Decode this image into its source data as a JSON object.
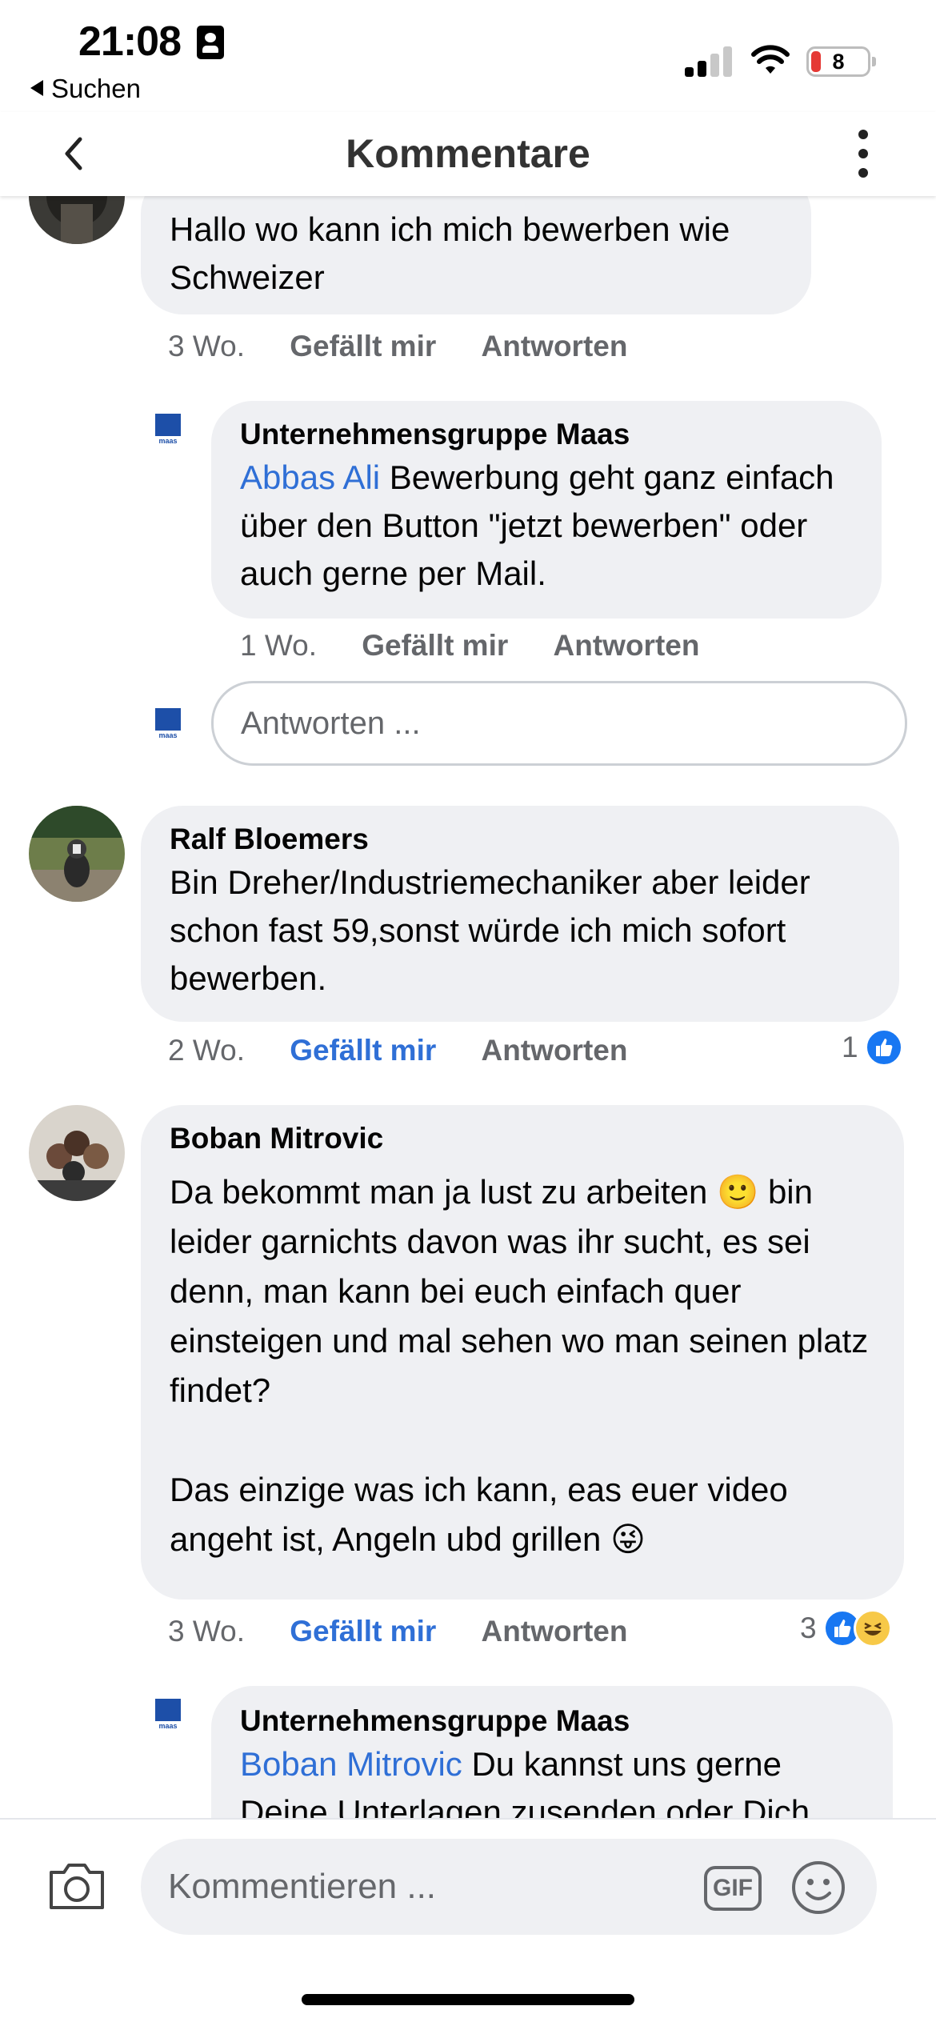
{
  "status_bar": {
    "time": "21:08",
    "back_app": "Suchen",
    "battery": "8"
  },
  "header": {
    "title": "Kommentare"
  },
  "comments": [
    {
      "text": "Hallo wo kann ich mich bewerben wie Schweizer",
      "time": "3 Wo.",
      "like": "Gefällt mir",
      "reply": "Antworten",
      "liked": false,
      "replies": [
        {
          "author": "Unternehmensgruppe Maas",
          "mention": "Abbas Ali",
          "text": " Bewerbung geht ganz einfach über den Button \"jetzt bewerben\" oder auch gerne per Mail.",
          "time": "1 Wo.",
          "like": "Gefällt mir",
          "reply": "Antworten"
        }
      ],
      "reply_input_placeholder": "Antworten ..."
    },
    {
      "author": "Ralf Bloemers",
      "text": "Bin Dreher/Industriemechaniker aber leider schon fast 59,sonst würde ich mich sofort bewerben.",
      "time": "2 Wo.",
      "like": "Gefällt mir",
      "reply": "Antworten",
      "liked": true,
      "reaction_count": "1"
    },
    {
      "author": "Boban Mitrovic",
      "text": "Da bekommt man ja lust zu arbeiten 🙂 bin leider garnichts davon was ihr sucht, es sei denn, man kann bei euch einfach quer einsteigen und mal sehen wo man seinen platz findet?\n\nDas einzige was ich kann, eas euer video angeht ist, Angeln ubd grillen 😜",
      "time": "3 Wo.",
      "like": "Gefällt mir",
      "reply": "Antworten",
      "liked": true,
      "reaction_count": "3",
      "replies": [
        {
          "author": "Unternehmensgruppe Maas",
          "mention": "Boban Mitrovic",
          "text": " Du kannst uns gerne Deine Unterlagen zusenden oder Dich"
        }
      ]
    }
  ],
  "footer": {
    "comment_placeholder": "Kommentieren ...",
    "gif_label": "GIF"
  },
  "brand": {
    "logo_text": "maas"
  },
  "colors": {
    "accent": "#2f6fd6",
    "bubble": "#eff0f3",
    "meta": "#65676b",
    "maas_blue": "#1d4fa8"
  }
}
